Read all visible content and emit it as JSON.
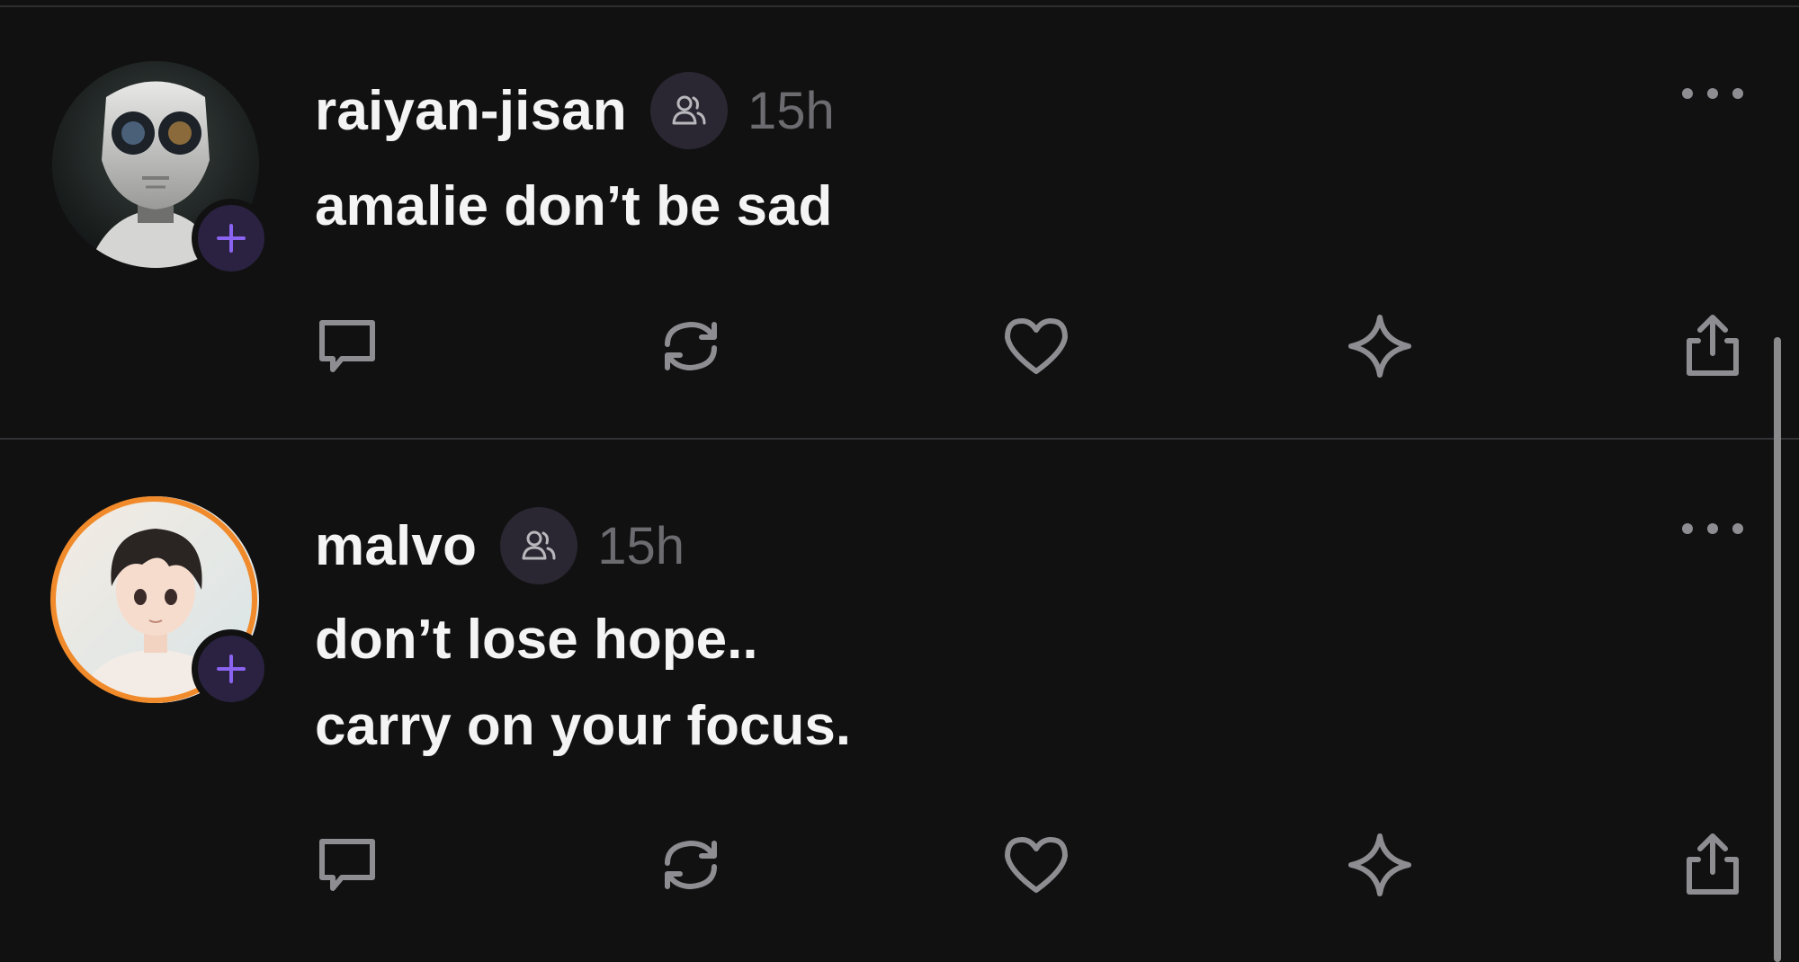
{
  "posts": [
    {
      "username": "raiyan-jisan",
      "time": "15h",
      "text_lines": [
        "amalie don’t be sad"
      ],
      "avatar_icon": "robot-avatar",
      "follow_icon": "plus-icon",
      "audience_icon": "group-icon"
    },
    {
      "username": "malvo",
      "time": "15h",
      "text_lines": [
        "don’t lose hope..",
        "carry on your focus."
      ],
      "avatar_icon": "anime-boy-avatar",
      "follow_icon": "plus-icon",
      "audience_icon": "group-icon"
    }
  ],
  "action_icons": [
    "reply-icon",
    "repost-icon",
    "like-icon",
    "sparkle-icon",
    "share-icon"
  ],
  "colors": {
    "background": "#111112",
    "accent_purple": "#8a63f0",
    "badge_bg": "#2a2240",
    "muted_text": "#6c6c70",
    "avatar_ring": "#f08a2a"
  }
}
